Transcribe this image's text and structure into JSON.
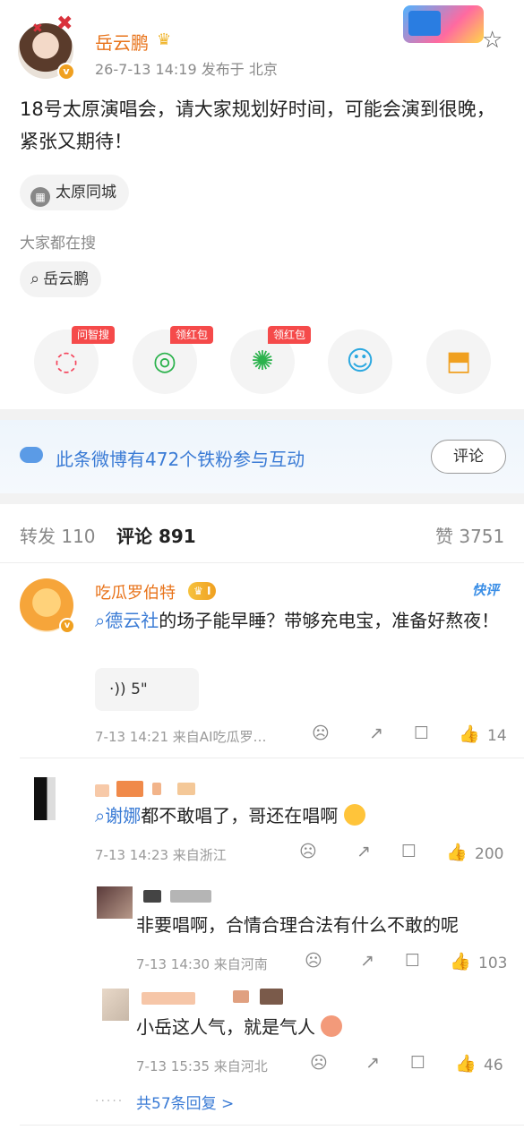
{
  "post": {
    "author": "岳云鹏",
    "meta": "26-7-13 14:19  发布于 北京",
    "content": "18号太原演唱会，请大家规划好时间，可能会演到很晚，紧张又期待！",
    "location_chip": "太原同城",
    "hot_search_label": "大家都在搜",
    "hot_search_chip": "岳云鹏",
    "share_tags": [
      "问智搜",
      "领红包",
      "领红包"
    ]
  },
  "interaction": {
    "text": "此条微博有472个铁粉参与互动",
    "button": "评论"
  },
  "tabs": {
    "repost": "转发 110",
    "comment": "评论 891",
    "like": "赞 3751"
  },
  "comments": [
    {
      "name": "吃瓜罗伯特",
      "level": "I",
      "badge": "快评",
      "link": "德云社",
      "text": "的场子能早睡？带够充电宝，准备好熬夜！",
      "voice": "5\"",
      "meta": "7-13 14:21  来自AI吃瓜罗…",
      "likes": "14"
    },
    {
      "link": "谢娜",
      "text": "都不敢唱了，哥还在唱啊",
      "meta": "7-13 14:23  来自浙江",
      "likes": "200"
    }
  ],
  "replies": [
    {
      "text": "非要唱啊，合情合理合法有什么不敢的呢",
      "meta": "7-13 14:30  来自河南",
      "likes": "103"
    },
    {
      "text": "小岳这人气，就是气人",
      "meta": "7-13 15:35  来自河北",
      "likes": "46"
    }
  ],
  "more_replies": "共57条回复 >",
  "colors": {
    "accent_orange": "#e8731a",
    "link_blue": "#3a7bd5",
    "tag_red": "#f54a4a"
  },
  "icons": [
    "star-icon",
    "location-icon",
    "search-icon",
    "smart-search-icon",
    "wechat-icon",
    "moments-icon",
    "qq-icon",
    "save-image-icon",
    "emoji-icon",
    "share-icon",
    "comment-icon",
    "like-icon",
    "voice-icon"
  ]
}
